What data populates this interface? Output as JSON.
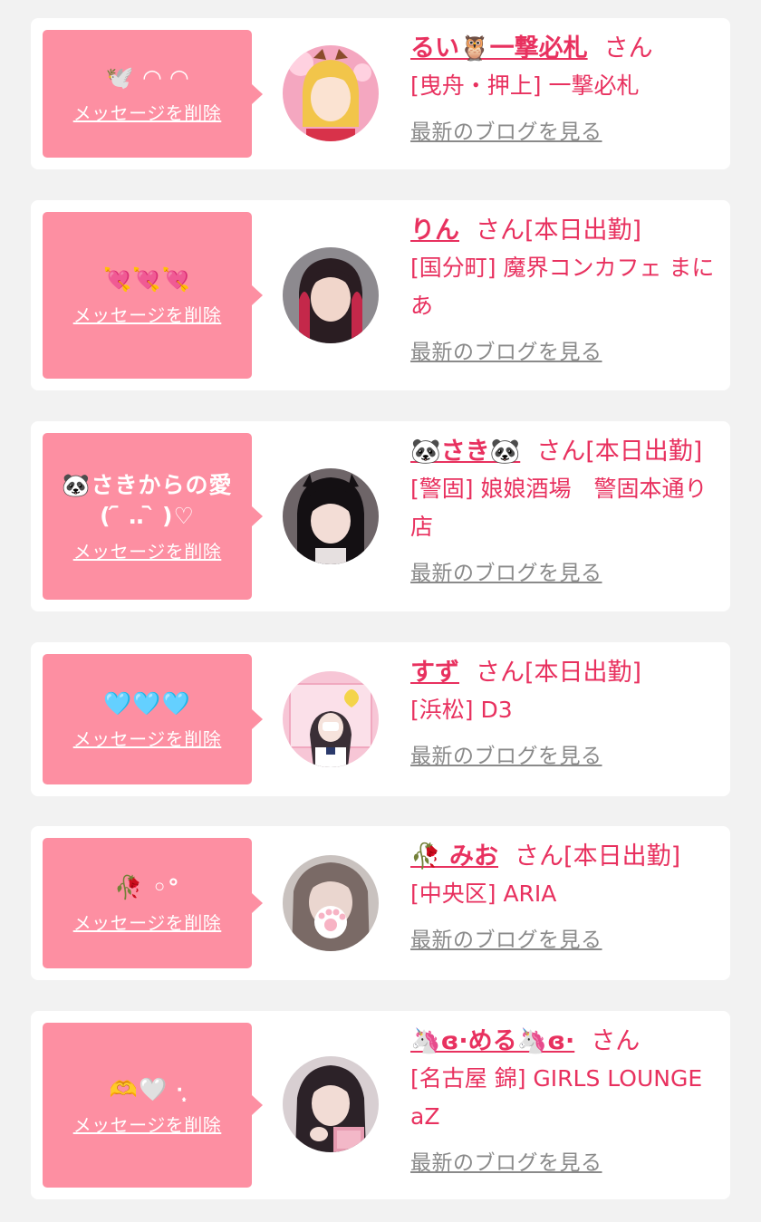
{
  "colors": {
    "page_bg": "#f2f2f2",
    "card_bg": "#ffffff",
    "bubble_bg": "#fd8fa2",
    "accent": "#e8315f",
    "link_gray": "#8a8a8a"
  },
  "entries": [
    {
      "message": "🕊️ ◠ ◠",
      "delete_label": "メッセージを削除",
      "name": "るい🦉一撃必札",
      "san": "さん",
      "status": "",
      "shop": "[曳舟・押上] 一撃必札",
      "blog_label": "最新のブログを見る",
      "avatar_icon": "blonde-girl-avatar"
    },
    {
      "message": "💘💘💘",
      "delete_label": "メッセージを削除",
      "name": "りん",
      "san": "さん",
      "status": "[本日出勤]",
      "shop": "[国分町] 魔界コンカフェ まにあ",
      "blog_label": "最新のブログを見る",
      "avatar_icon": "red-hair-girl-avatar"
    },
    {
      "message": "🐼さきからの愛\n( ᷇ ‥ ᷆ )♡",
      "delete_label": "メッセージを削除",
      "name": "🐼さき🐼",
      "san": "さん",
      "status": "[本日出勤]",
      "shop": "[警固] 娘娘酒場　警固本通り店",
      "blog_label": "最新のブログを見る",
      "avatar_icon": "black-hair-girl-avatar"
    },
    {
      "message": "🩵🩵🩵",
      "delete_label": "メッセージを削除",
      "name": "すず",
      "san": "さん",
      "status": "[本日出勤]",
      "shop": "[浜松] D3",
      "blog_label": "最新のブログを見る",
      "avatar_icon": "pink-background-girl-avatar"
    },
    {
      "message": "🥀 ◦°",
      "delete_label": "メッセージを削除",
      "name": "🥀 みお",
      "san": "さん",
      "status": "[本日出勤]",
      "shop": "[中央区] ARIA",
      "blog_label": "最新のブログを見る",
      "avatar_icon": "paw-sticker-girl-avatar"
    },
    {
      "message": "🫶🤍 ·̩͙",
      "delete_label": "メッセージを削除",
      "name": "🦄ɞ·める🦄ɞ·",
      "san": "さん",
      "status": "",
      "shop": "[名古屋 錦] GIRLS LOUNGE aZ",
      "blog_label": "最新のブログを見る",
      "avatar_icon": "heart-pose-girl-avatar"
    }
  ]
}
